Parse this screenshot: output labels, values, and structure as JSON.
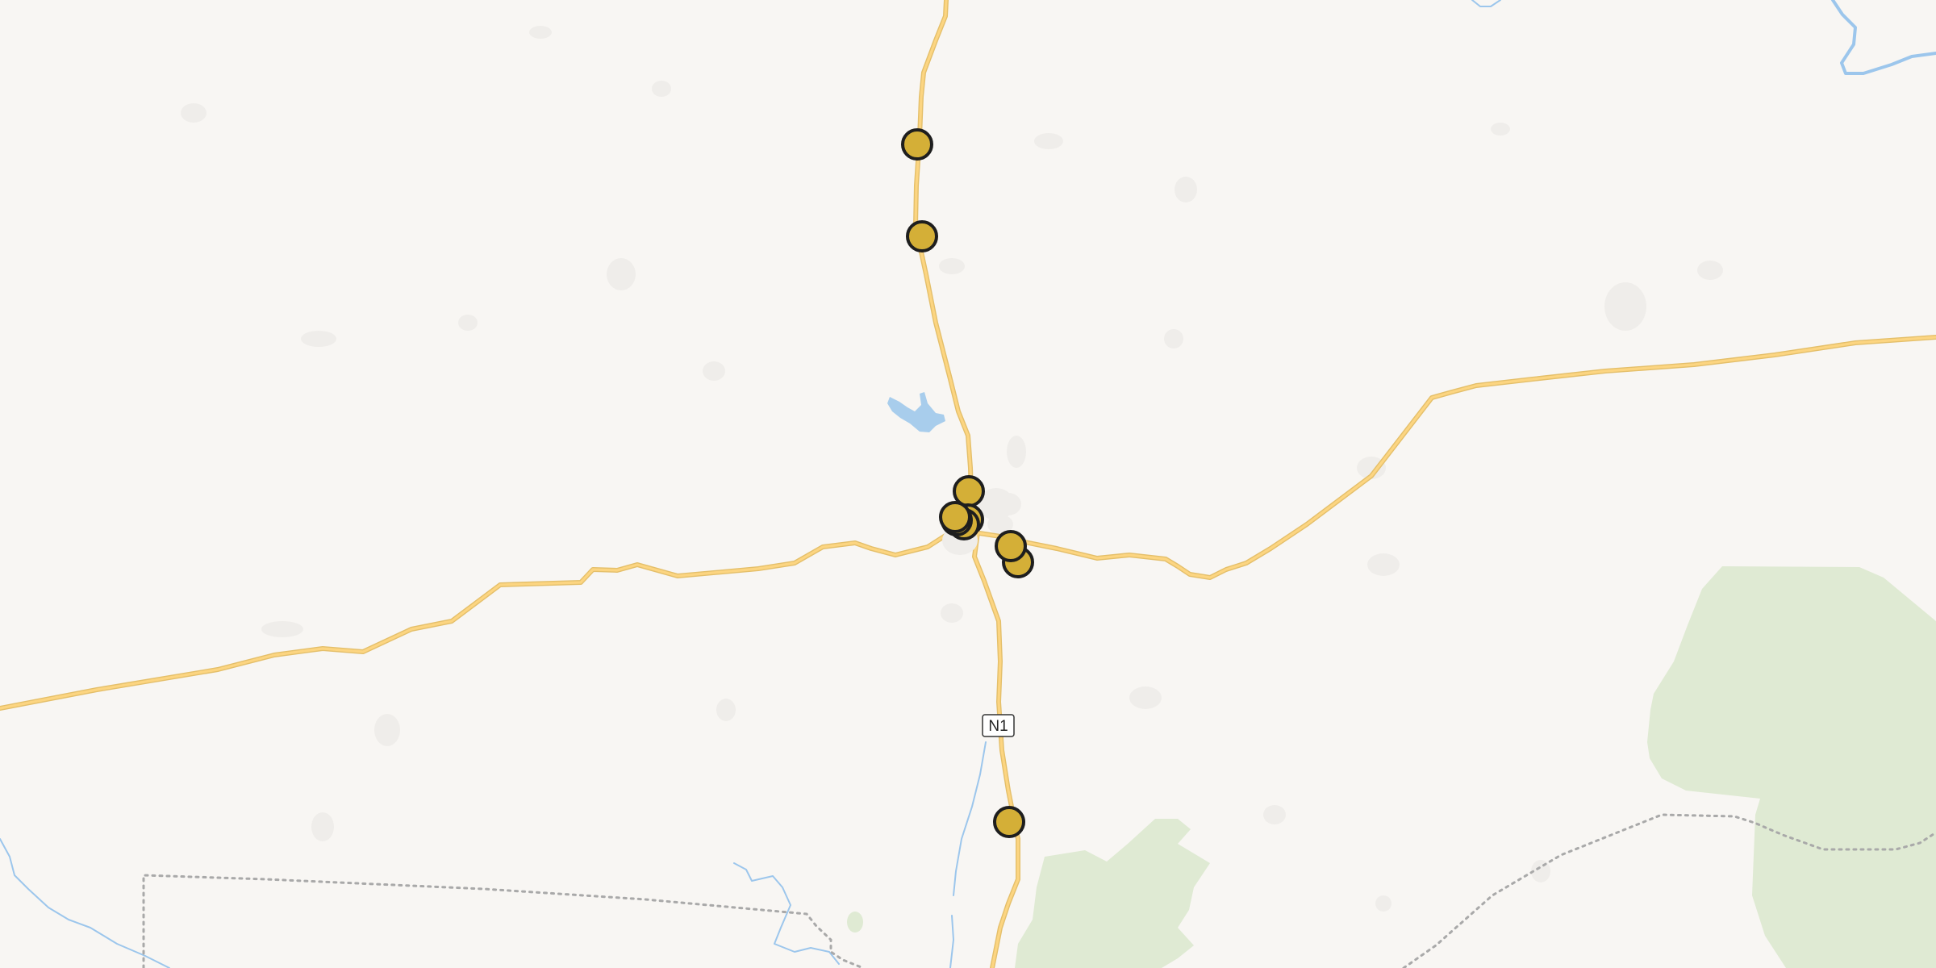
{
  "map": {
    "road_shield": {
      "label": "N1"
    },
    "colors": {
      "land": "#f8f6f3",
      "road": "#fcd581",
      "road_casing": "#e4bf6a",
      "water": "#9cc6ec",
      "park": "#dfead3",
      "boundary": "#a9a9a9",
      "marker_fill": "#d4af37",
      "marker_stroke": "#1e1e1e"
    },
    "marker_count": 10
  }
}
